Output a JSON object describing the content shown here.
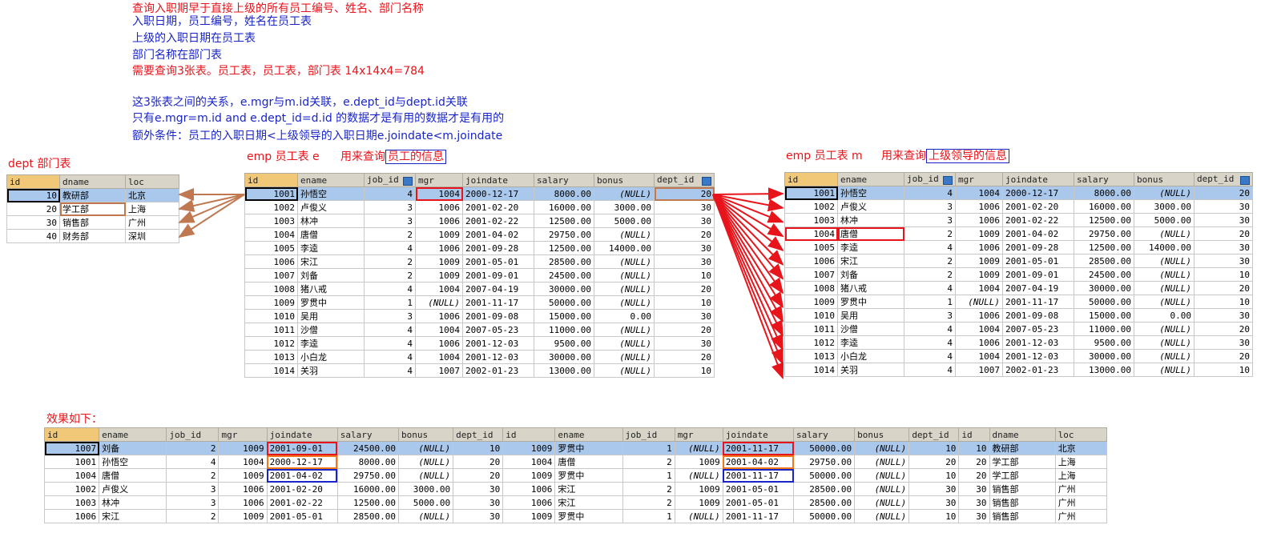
{
  "notes": {
    "line1": "查询入职期早于直接上级的所有员工编号、姓名、部门名称",
    "line2": "入职日期，员工编号，姓名在员工表",
    "line3": "上级的入职日期在员工表",
    "line4": "部门名称在部门表",
    "line5": "需要查询3张表。员工表，员工表，部门表 14x14x4=784",
    "line6": "这3张表之间的关系，e.mgr与m.id关联，e.dept_id与dept.id关联",
    "line7": "只有e.mgr=m.id and e.dept_id=d.id 的数据才是有用的数据才是有用的",
    "line8": "额外条件：员工的入职日期<上级领导的入职日期e.joindate<m.joindate"
  },
  "labels": {
    "dept_title": "dept 部门表",
    "emp_e_title": "emp 员工表  e",
    "emp_e_use_prefix": "用来查询",
    "emp_e_use_boxed": "员工的信息",
    "emp_m_title": "emp 员工表  m",
    "emp_m_use_prefix": "用来查询",
    "emp_m_use_boxed": "上级领导的信息",
    "result_title": "效果如下："
  },
  "colors": {
    "red": "#e8141b",
    "blue": "#1a25c8",
    "orange": "#f07818",
    "brown": "#c07850",
    "selected_row": "#aac8ec",
    "header": "#d8d4c8"
  },
  "dept": {
    "columns": [
      "id",
      "dname",
      "loc"
    ],
    "rows": [
      [
        "10",
        "教研部",
        "北京"
      ],
      [
        "20",
        "学工部",
        "上海"
      ],
      [
        "30",
        "销售部",
        "广州"
      ],
      [
        "40",
        "财务部",
        "深圳"
      ]
    ]
  },
  "emp_e": {
    "columns": [
      "id",
      "ename",
      "job_id",
      "mgr",
      "joindate",
      "salary",
      "bonus",
      "dept_id"
    ],
    "rows": [
      [
        "1001",
        "孙悟空",
        "4",
        "1004",
        "2000-12-17",
        "8000.00",
        "(NULL)",
        "20"
      ],
      [
        "1002",
        "卢俊义",
        "3",
        "1006",
        "2001-02-20",
        "16000.00",
        "3000.00",
        "30"
      ],
      [
        "1003",
        "林冲",
        "3",
        "1006",
        "2001-02-22",
        "12500.00",
        "5000.00",
        "30"
      ],
      [
        "1004",
        "唐僧",
        "2",
        "1009",
        "2001-04-02",
        "29750.00",
        "(NULL)",
        "20"
      ],
      [
        "1005",
        "李逵",
        "4",
        "1006",
        "2001-09-28",
        "12500.00",
        "14000.00",
        "30"
      ],
      [
        "1006",
        "宋江",
        "2",
        "1009",
        "2001-05-01",
        "28500.00",
        "(NULL)",
        "30"
      ],
      [
        "1007",
        "刘备",
        "2",
        "1009",
        "2001-09-01",
        "24500.00",
        "(NULL)",
        "10"
      ],
      [
        "1008",
        "猪八戒",
        "4",
        "1004",
        "2007-04-19",
        "30000.00",
        "(NULL)",
        "20"
      ],
      [
        "1009",
        "罗贯中",
        "1",
        "(NULL)",
        "2001-11-17",
        "50000.00",
        "(NULL)",
        "10"
      ],
      [
        "1010",
        "吴用",
        "3",
        "1006",
        "2001-09-08",
        "15000.00",
        "0.00",
        "30"
      ],
      [
        "1011",
        "沙僧",
        "4",
        "1004",
        "2007-05-23",
        "11000.00",
        "(NULL)",
        "20"
      ],
      [
        "1012",
        "李逵",
        "4",
        "1006",
        "2001-12-03",
        "9500.00",
        "(NULL)",
        "30"
      ],
      [
        "1013",
        "小白龙",
        "4",
        "1004",
        "2001-12-03",
        "30000.00",
        "(NULL)",
        "20"
      ],
      [
        "1014",
        "关羽",
        "4",
        "1007",
        "2002-01-23",
        "13000.00",
        "(NULL)",
        "10"
      ]
    ]
  },
  "emp_m": {
    "columns": [
      "id",
      "ename",
      "job_id",
      "mgr",
      "joindate",
      "salary",
      "bonus",
      "dept_id"
    ],
    "rows": [
      [
        "1001",
        "孙悟空",
        "4",
        "1004",
        "2000-12-17",
        "8000.00",
        "(NULL)",
        "20"
      ],
      [
        "1002",
        "卢俊义",
        "3",
        "1006",
        "2001-02-20",
        "16000.00",
        "3000.00",
        "30"
      ],
      [
        "1003",
        "林冲",
        "3",
        "1006",
        "2001-02-22",
        "12500.00",
        "5000.00",
        "30"
      ],
      [
        "1004",
        "唐僧",
        "2",
        "1009",
        "2001-04-02",
        "29750.00",
        "(NULL)",
        "20"
      ],
      [
        "1005",
        "李逵",
        "4",
        "1006",
        "2001-09-28",
        "12500.00",
        "14000.00",
        "30"
      ],
      [
        "1006",
        "宋江",
        "2",
        "1009",
        "2001-05-01",
        "28500.00",
        "(NULL)",
        "30"
      ],
      [
        "1007",
        "刘备",
        "2",
        "1009",
        "2001-09-01",
        "24500.00",
        "(NULL)",
        "10"
      ],
      [
        "1008",
        "猪八戒",
        "4",
        "1004",
        "2007-04-19",
        "30000.00",
        "(NULL)",
        "20"
      ],
      [
        "1009",
        "罗贯中",
        "1",
        "(NULL)",
        "2001-11-17",
        "50000.00",
        "(NULL)",
        "10"
      ],
      [
        "1010",
        "吴用",
        "3",
        "1006",
        "2001-09-08",
        "15000.00",
        "0.00",
        "30"
      ],
      [
        "1011",
        "沙僧",
        "4",
        "1004",
        "2007-05-23",
        "11000.00",
        "(NULL)",
        "20"
      ],
      [
        "1012",
        "李逵",
        "4",
        "1006",
        "2001-12-03",
        "9500.00",
        "(NULL)",
        "30"
      ],
      [
        "1013",
        "小白龙",
        "4",
        "1004",
        "2001-12-03",
        "30000.00",
        "(NULL)",
        "20"
      ],
      [
        "1014",
        "关羽",
        "4",
        "1007",
        "2002-01-23",
        "13000.00",
        "(NULL)",
        "10"
      ]
    ]
  },
  "result": {
    "columns": [
      "id",
      "ename",
      "job_id",
      "mgr",
      "joindate",
      "salary",
      "bonus",
      "dept_id",
      "id",
      "ename",
      "job_id",
      "mgr",
      "joindate",
      "salary",
      "bonus",
      "dept_id",
      "id",
      "dname",
      "loc"
    ],
    "rows": [
      [
        "1007",
        "刘备",
        "2",
        "1009",
        "2001-09-01",
        "24500.00",
        "(NULL)",
        "10",
        "1009",
        "罗贯中",
        "1",
        "(NULL)",
        "2001-11-17",
        "50000.00",
        "(NULL)",
        "10",
        "10",
        "教研部",
        "北京"
      ],
      [
        "1001",
        "孙悟空",
        "4",
        "1004",
        "2000-12-17",
        "8000.00",
        "(NULL)",
        "20",
        "1004",
        "唐僧",
        "2",
        "1009",
        "2001-04-02",
        "29750.00",
        "(NULL)",
        "20",
        "20",
        "学工部",
        "上海"
      ],
      [
        "1004",
        "唐僧",
        "2",
        "1009",
        "2001-04-02",
        "29750.00",
        "(NULL)",
        "20",
        "1009",
        "罗贯中",
        "1",
        "(NULL)",
        "2001-11-17",
        "50000.00",
        "(NULL)",
        "10",
        "20",
        "学工部",
        "上海"
      ],
      [
        "1002",
        "卢俊义",
        "3",
        "1006",
        "2001-02-20",
        "16000.00",
        "3000.00",
        "30",
        "1006",
        "宋江",
        "2",
        "1009",
        "2001-05-01",
        "28500.00",
        "(NULL)",
        "30",
        "30",
        "销售部",
        "广州"
      ],
      [
        "1003",
        "林冲",
        "3",
        "1006",
        "2001-02-22",
        "12500.00",
        "5000.00",
        "30",
        "1006",
        "宋江",
        "2",
        "1009",
        "2001-05-01",
        "28500.00",
        "(NULL)",
        "30",
        "30",
        "销售部",
        "广州"
      ],
      [
        "1006",
        "宋江",
        "2",
        "1009",
        "2001-05-01",
        "28500.00",
        "(NULL)",
        "30",
        "1009",
        "罗贯中",
        "1",
        "(NULL)",
        "2001-11-17",
        "50000.00",
        "(NULL)",
        "10",
        "30",
        "销售部",
        "广州"
      ]
    ]
  }
}
